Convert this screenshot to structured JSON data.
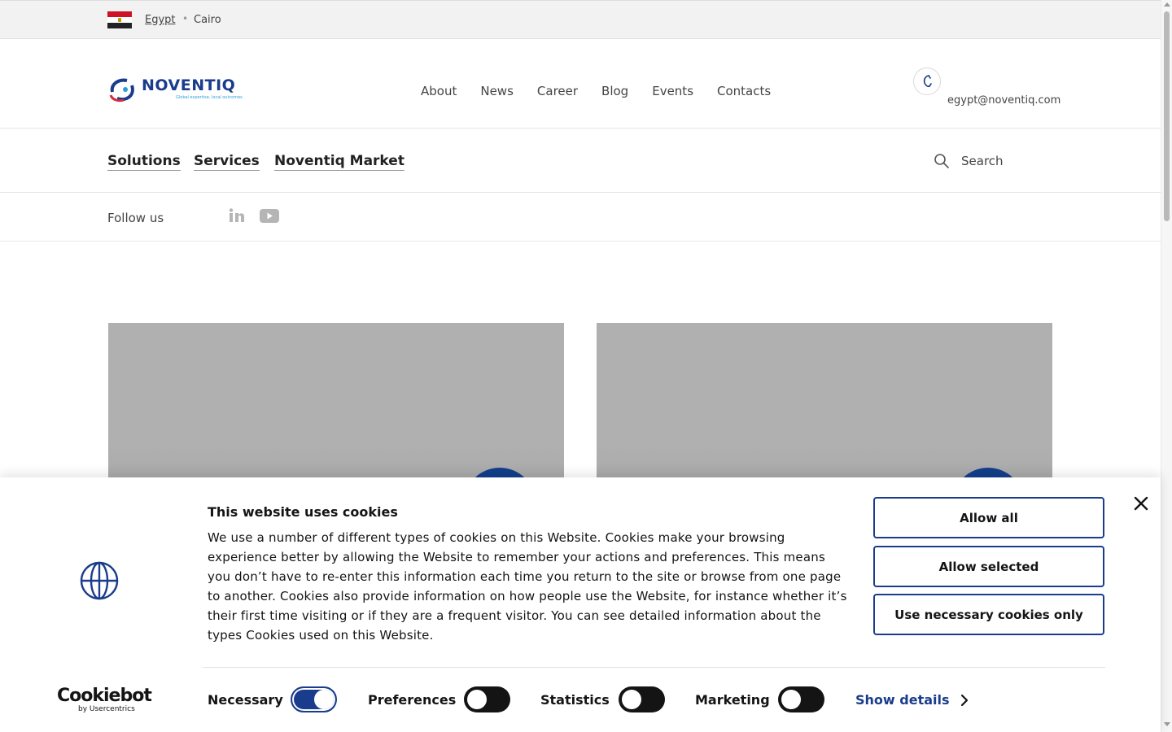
{
  "location": {
    "country": "Egypt",
    "separator": "•",
    "city": "Cairo"
  },
  "header": {
    "logo_text": "NOVENTIQ",
    "logo_tagline": "Global expertise, local outcomes",
    "nav": [
      "About",
      "News",
      "Career",
      "Blog",
      "Events",
      "Contacts"
    ],
    "email": "egypt@noventiq.com"
  },
  "subnav": {
    "items": [
      "Solutions",
      "Services",
      "Noventiq Market"
    ],
    "search_label": "Search"
  },
  "follow": {
    "label": "Follow us"
  },
  "cookie": {
    "title": "This website uses cookies",
    "text": "We use a number of different types of cookies on this Website. Cookies make your browsing experience better by allowing the Website to remember your actions and preferences. This means you don’t have to re-enter this information each time you return to the site or browse from one page to another. Cookies also provide information on how people use the Website, for instance whether it’s their first time visiting or if they are a frequent visitor. You can see detailed information about the types Cookies used on this Website.",
    "buttons": {
      "allow_all": "Allow all",
      "allow_selected": "Allow selected",
      "necessary_only": "Use necessary cookies only"
    },
    "toggles": [
      {
        "label": "Necessary",
        "on": true
      },
      {
        "label": "Preferences",
        "on": false
      },
      {
        "label": "Statistics",
        "on": false
      },
      {
        "label": "Marketing",
        "on": false
      }
    ],
    "show_details": "Show details",
    "brand_main": "Cookiebot",
    "brand_sub": "by Usercentrics"
  },
  "colors": {
    "accent": "#1a3c8c",
    "card": "#b0b0b0",
    "topbar": "#f2f2f2"
  }
}
